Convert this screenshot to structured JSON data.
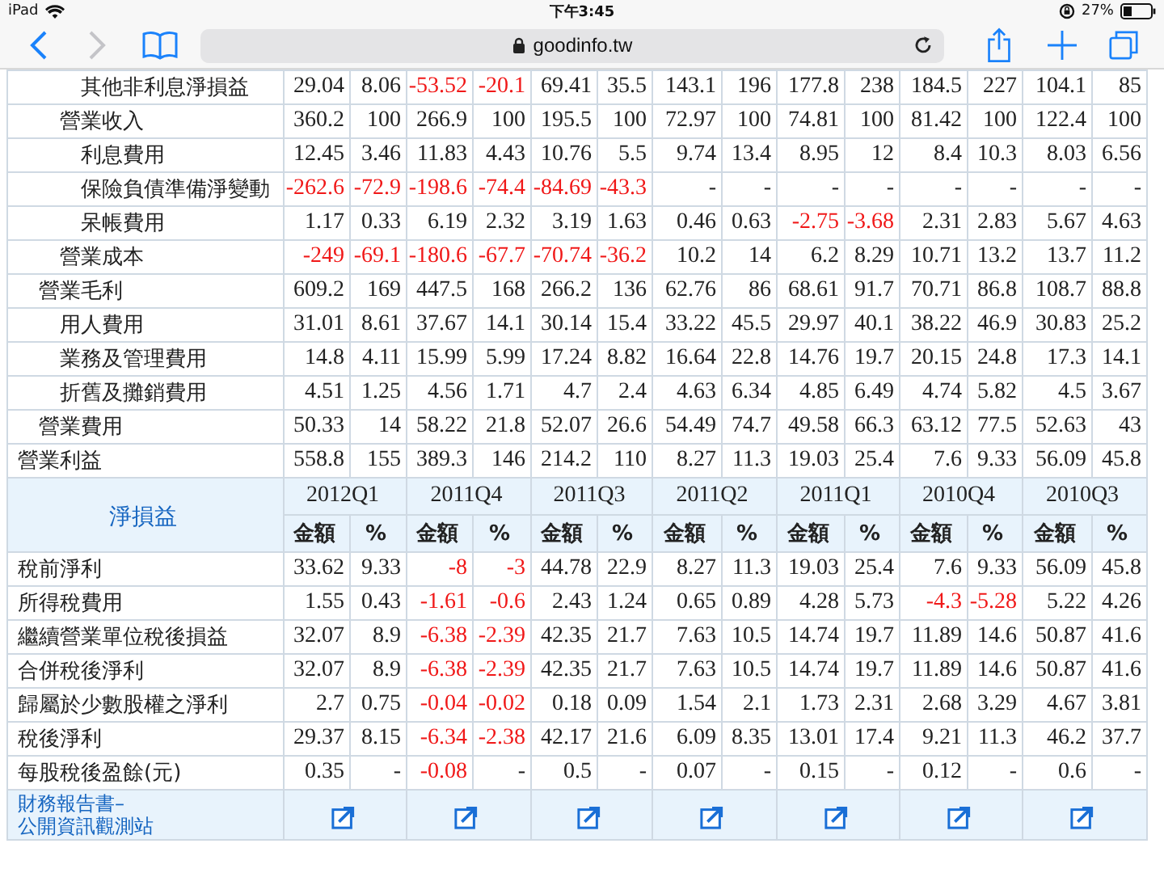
{
  "browser": {
    "device": "iPad",
    "time": "下午3:45",
    "battery": "27%",
    "url": "goodinfo.tw",
    "forward_disabled": true
  },
  "income_rows": [
    {
      "label": "營業利益",
      "values": [
        "558.8",
        "155",
        "389.3",
        "146",
        "214.2",
        "110",
        "8.27",
        "11.3",
        "19.03",
        "25.4",
        "7.6",
        "9.33",
        "56.09",
        "45.8"
      ],
      "negative": [
        false,
        false,
        false,
        false,
        false,
        false,
        false,
        false,
        false,
        false,
        false,
        false,
        false,
        false
      ],
      "children": [
        {
          "label": "營業毛利",
          "values": [
            "609.2",
            "169",
            "447.5",
            "168",
            "266.2",
            "136",
            "62.76",
            "86",
            "68.61",
            "91.7",
            "70.71",
            "86.8",
            "108.7",
            "88.8"
          ],
          "negative": [
            false,
            false,
            false,
            false,
            false,
            false,
            false,
            false,
            false,
            false,
            false,
            false,
            false,
            false
          ],
          "children": [
            {
              "label": "營業收入",
              "values": [
                "360.2",
                "100",
                "266.9",
                "100",
                "195.5",
                "100",
                "72.97",
                "100",
                "74.81",
                "100",
                "81.42",
                "100",
                "122.4",
                "100"
              ],
              "negative": [
                false,
                false,
                false,
                false,
                false,
                false,
                false,
                false,
                false,
                false,
                false,
                false,
                false,
                false
              ],
              "children": [
                {
                  "label": "其他非利息淨損益",
                  "values": [
                    "29.04",
                    "8.06",
                    "-53.52",
                    "-20.1",
                    "69.41",
                    "35.5",
                    "143.1",
                    "196",
                    "177.8",
                    "238",
                    "184.5",
                    "227",
                    "104.1",
                    "85"
                  ],
                  "negative": [
                    false,
                    false,
                    true,
                    true,
                    false,
                    false,
                    false,
                    false,
                    false,
                    false,
                    false,
                    false,
                    false,
                    false
                  ]
                }
              ]
            },
            {
              "label": "營業成本",
              "values": [
                "-249",
                "-69.1",
                "-180.6",
                "-67.7",
                "-70.74",
                "-36.2",
                "10.2",
                "14",
                "6.2",
                "8.29",
                "10.71",
                "13.2",
                "13.7",
                "11.2"
              ],
              "negative": [
                true,
                true,
                true,
                true,
                true,
                true,
                false,
                false,
                false,
                false,
                false,
                false,
                false,
                false
              ],
              "children": [
                {
                  "label": "利息費用",
                  "values": [
                    "12.45",
                    "3.46",
                    "11.83",
                    "4.43",
                    "10.76",
                    "5.5",
                    "9.74",
                    "13.4",
                    "8.95",
                    "12",
                    "8.4",
                    "10.3",
                    "8.03",
                    "6.56"
                  ],
                  "negative": [
                    false,
                    false,
                    false,
                    false,
                    false,
                    false,
                    false,
                    false,
                    false,
                    false,
                    false,
                    false,
                    false,
                    false
                  ]
                },
                {
                  "label": "保險負債準備淨變動",
                  "values": [
                    "-262.6",
                    "-72.9",
                    "-198.6",
                    "-74.4",
                    "-84.69",
                    "-43.3",
                    "-",
                    "-",
                    "-",
                    "-",
                    "-",
                    "-",
                    "-",
                    "-"
                  ],
                  "negative": [
                    true,
                    true,
                    true,
                    true,
                    true,
                    true,
                    false,
                    false,
                    false,
                    false,
                    false,
                    false,
                    false,
                    false
                  ]
                },
                {
                  "label": "呆帳費用",
                  "values": [
                    "1.17",
                    "0.33",
                    "6.19",
                    "2.32",
                    "3.19",
                    "1.63",
                    "0.46",
                    "0.63",
                    "-2.75",
                    "-3.68",
                    "2.31",
                    "2.83",
                    "5.67",
                    "4.63"
                  ],
                  "negative": [
                    false,
                    false,
                    false,
                    false,
                    false,
                    false,
                    false,
                    false,
                    true,
                    true,
                    false,
                    false,
                    false,
                    false
                  ]
                }
              ]
            }
          ]
        },
        {
          "label": "營業費用",
          "values": [
            "50.33",
            "14",
            "58.22",
            "21.8",
            "52.07",
            "26.6",
            "54.49",
            "74.7",
            "49.58",
            "66.3",
            "63.12",
            "77.5",
            "52.63",
            "43"
          ],
          "negative": [
            false,
            false,
            false,
            false,
            false,
            false,
            false,
            false,
            false,
            false,
            false,
            false,
            false,
            false
          ],
          "children": [
            {
              "label": "用人費用",
              "values": [
                "31.01",
                "8.61",
                "37.67",
                "14.1",
                "30.14",
                "15.4",
                "33.22",
                "45.5",
                "29.97",
                "40.1",
                "38.22",
                "46.9",
                "30.83",
                "25.2"
              ],
              "negative": [
                false,
                false,
                false,
                false,
                false,
                false,
                false,
                false,
                false,
                false,
                false,
                false,
                false,
                false
              ]
            },
            {
              "label": "業務及管理費用",
              "values": [
                "14.8",
                "4.11",
                "15.99",
                "5.99",
                "17.24",
                "8.82",
                "16.64",
                "22.8",
                "14.76",
                "19.7",
                "20.15",
                "24.8",
                "17.3",
                "14.1"
              ],
              "negative": [
                false,
                false,
                false,
                false,
                false,
                false,
                false,
                false,
                false,
                false,
                false,
                false,
                false,
                false
              ]
            },
            {
              "label": "折舊及攤銷費用",
              "values": [
                "4.51",
                "1.25",
                "4.56",
                "1.71",
                "4.7",
                "2.4",
                "4.63",
                "6.34",
                "4.85",
                "6.49",
                "4.74",
                "5.82",
                "4.5",
                "3.67"
              ],
              "negative": [
                false,
                false,
                false,
                false,
                false,
                false,
                false,
                false,
                false,
                false,
                false,
                false,
                false,
                false
              ]
            }
          ]
        }
      ]
    }
  ],
  "net_section": {
    "title": "淨損益",
    "quarters": [
      {
        "label": "2012Q1",
        "amount": "金額",
        "pct": "%"
      },
      {
        "label": "2011Q4",
        "amount": "金額",
        "pct": "%"
      },
      {
        "label": "2011Q3",
        "amount": "金額",
        "pct": "%"
      },
      {
        "label": "2011Q2",
        "amount": "金額",
        "pct": "%"
      },
      {
        "label": "2011Q1",
        "amount": "金額",
        "pct": "%"
      },
      {
        "label": "2010Q4",
        "amount": "金額",
        "pct": "%"
      },
      {
        "label": "2010Q3",
        "amount": "金額",
        "pct": "%"
      }
    ],
    "rows": [
      {
        "label": "稅前淨利",
        "values": [
          "33.62",
          "9.33",
          "-8",
          "-3",
          "44.78",
          "22.9",
          "8.27",
          "11.3",
          "19.03",
          "25.4",
          "7.6",
          "9.33",
          "56.09",
          "45.8"
        ],
        "negative": [
          false,
          false,
          true,
          true,
          false,
          false,
          false,
          false,
          false,
          false,
          false,
          false,
          false,
          false
        ]
      },
      {
        "label": "所得稅費用",
        "values": [
          "1.55",
          "0.43",
          "-1.61",
          "-0.6",
          "2.43",
          "1.24",
          "0.65",
          "0.89",
          "4.28",
          "5.73",
          "-4.3",
          "-5.28",
          "5.22",
          "4.26"
        ],
        "negative": [
          false,
          false,
          true,
          true,
          false,
          false,
          false,
          false,
          false,
          false,
          true,
          true,
          false,
          false
        ]
      },
      {
        "label": "繼續營業單位稅後損益",
        "values": [
          "32.07",
          "8.9",
          "-6.38",
          "-2.39",
          "42.35",
          "21.7",
          "7.63",
          "10.5",
          "14.74",
          "19.7",
          "11.89",
          "14.6",
          "50.87",
          "41.6"
        ],
        "negative": [
          false,
          false,
          true,
          true,
          false,
          false,
          false,
          false,
          false,
          false,
          false,
          false,
          false,
          false
        ]
      },
      {
        "label": "合併稅後淨利",
        "values": [
          "32.07",
          "8.9",
          "-6.38",
          "-2.39",
          "42.35",
          "21.7",
          "7.63",
          "10.5",
          "14.74",
          "19.7",
          "11.89",
          "14.6",
          "50.87",
          "41.6"
        ],
        "negative": [
          false,
          false,
          true,
          true,
          false,
          false,
          false,
          false,
          false,
          false,
          false,
          false,
          false,
          false
        ]
      },
      {
        "label": "歸屬於少數股權之淨利",
        "values": [
          "2.7",
          "0.75",
          "-0.04",
          "-0.02",
          "0.18",
          "0.09",
          "1.54",
          "2.1",
          "1.73",
          "2.31",
          "2.68",
          "3.29",
          "4.67",
          "3.81"
        ],
        "negative": [
          false,
          false,
          true,
          true,
          false,
          false,
          false,
          false,
          false,
          false,
          false,
          false,
          false,
          false
        ]
      },
      {
        "label": "稅後淨利",
        "values": [
          "29.37",
          "8.15",
          "-6.34",
          "-2.38",
          "42.17",
          "21.6",
          "6.09",
          "8.35",
          "13.01",
          "17.4",
          "9.21",
          "11.3",
          "46.2",
          "37.7"
        ],
        "negative": [
          false,
          false,
          true,
          true,
          false,
          false,
          false,
          false,
          false,
          false,
          false,
          false,
          false,
          false
        ]
      },
      {
        "label": "每股稅後盈餘(元)",
        "values": [
          "0.35",
          "-",
          "-0.08",
          "-",
          "0.5",
          "-",
          "0.07",
          "-",
          "0.15",
          "-",
          "0.12",
          "-",
          "0.6",
          "-"
        ],
        "negative": [
          false,
          false,
          true,
          false,
          false,
          false,
          false,
          false,
          false,
          false,
          false,
          false,
          false,
          false
        ]
      }
    ],
    "report_link": "財務報告書–\n公開資訊觀測站"
  }
}
